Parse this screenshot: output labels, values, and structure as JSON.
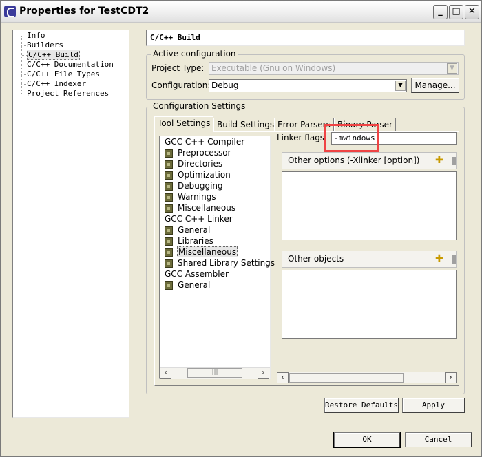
{
  "window": {
    "title": "Properties for TestCDT2",
    "controls": [
      "minimize",
      "maximize",
      "close"
    ]
  },
  "left_tree": {
    "items": [
      {
        "label": "Info"
      },
      {
        "label": "Builders"
      },
      {
        "label": "C/C++ Build",
        "selected": true
      },
      {
        "label": "C/C++ Documentation"
      },
      {
        "label": "C/C++ File Types"
      },
      {
        "label": "C/C++ Indexer"
      },
      {
        "label": "Project References"
      }
    ]
  },
  "page": {
    "title": "C/C++ Build"
  },
  "active_config": {
    "group_label": "Active configuration",
    "project_type_label": "Project Type:",
    "project_type_value": "Executable (Gnu on Windows)",
    "project_type_enabled": false,
    "configuration_label": "Configuration:",
    "configuration_value": "Debug",
    "manage_button": "Manage..."
  },
  "config_settings": {
    "group_label": "Configuration Settings",
    "tabs": [
      {
        "label": "Tool Settings",
        "active": true
      },
      {
        "label": "Build Settings"
      },
      {
        "label": "Error Parsers"
      },
      {
        "label": "Binary Parser"
      }
    ]
  },
  "tool_tree": {
    "items": [
      {
        "label": "GCC C++ Compiler",
        "level": 0
      },
      {
        "label": "Preprocessor",
        "level": 1
      },
      {
        "label": "Directories",
        "level": 1
      },
      {
        "label": "Optimization",
        "level": 1
      },
      {
        "label": "Debugging",
        "level": 1
      },
      {
        "label": "Warnings",
        "level": 1
      },
      {
        "label": "Miscellaneous",
        "level": 1
      },
      {
        "label": "GCC C++ Linker",
        "level": 0
      },
      {
        "label": "General",
        "level": 1
      },
      {
        "label": "Libraries",
        "level": 1
      },
      {
        "label": "Miscellaneous",
        "level": 1,
        "selected": true
      },
      {
        "label": "Shared Library Settings",
        "level": 1
      },
      {
        "label": "GCC Assembler",
        "level": 0
      },
      {
        "label": "General",
        "level": 1
      }
    ],
    "scroll_thumb_glyph": "|||"
  },
  "linker": {
    "flags_label": "Linker flags",
    "flags_value": "-mwindows",
    "highlight_color": "#ef4444",
    "other_options_label": "Other options (-Xlinker [option])",
    "other_objects_label": "Other objects"
  },
  "footer": {
    "restore_defaults": "Restore Defaults",
    "apply": "Apply",
    "ok": "OK",
    "cancel": "Cancel"
  },
  "icons": {
    "add": "add-icon",
    "scroll_left": "‹",
    "scroll_right": "›",
    "dropdown": "▼"
  }
}
